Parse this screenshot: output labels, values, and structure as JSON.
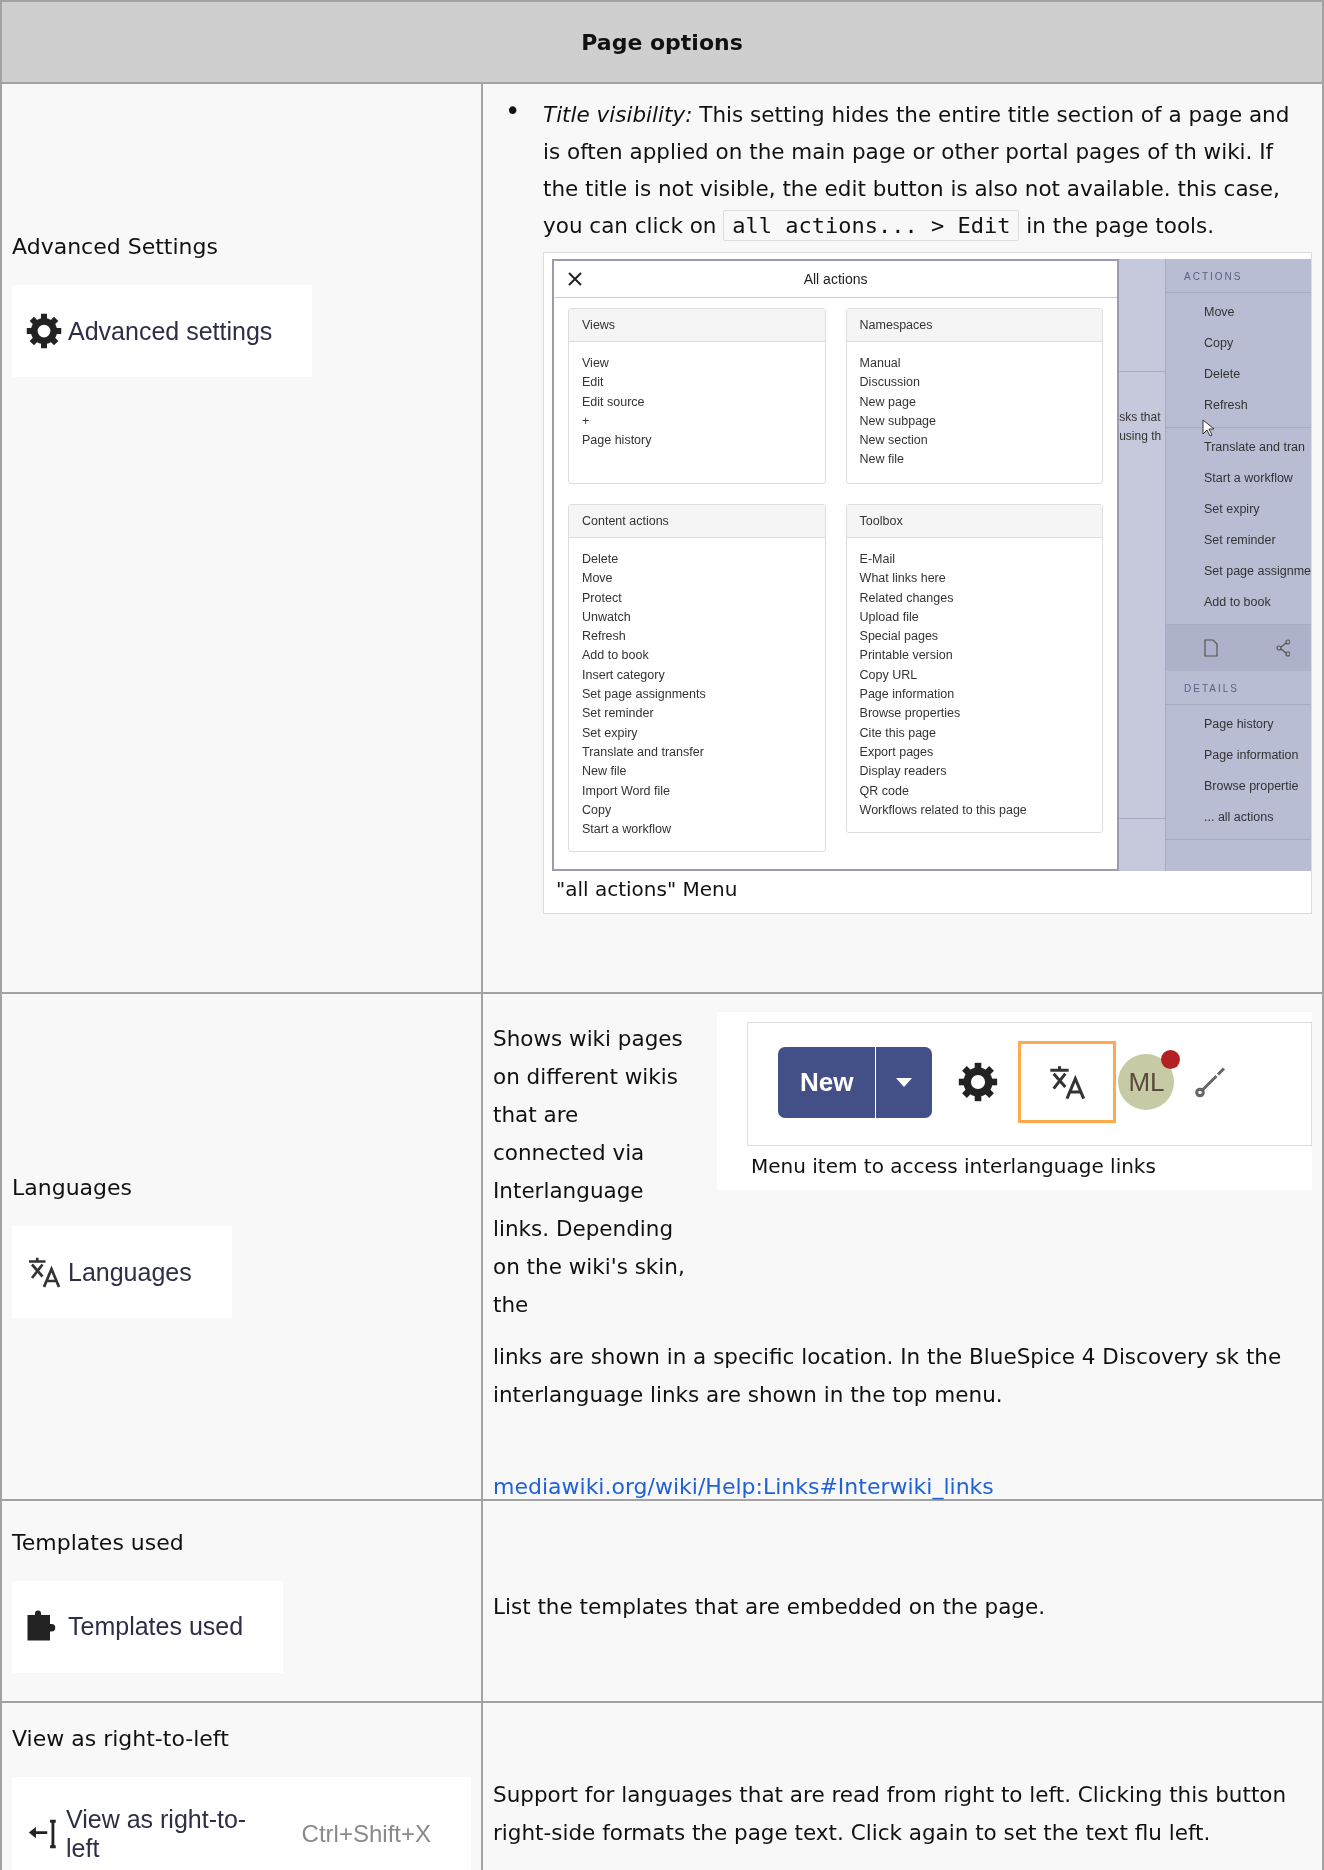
{
  "table": {
    "header": "Page options",
    "rows": [
      {
        "kind": "bullet_figure",
        "label": "Advanced Settings",
        "button": {
          "label": "Advanced settings"
        },
        "bullet": {
          "marker": "•",
          "text_before": "*Title visibility:* This setting hides the entire title section of a page and is often applied on the main page or other portal pages of th wiki. If the title is not visible, the edit button is also not available. this case, you can click on",
          "code": "all actions... > Edit",
          "text_after": "in the page tools."
        },
        "figure": {
          "dialog": {
            "title": "All actions",
            "panels": [
              {
                "title": "Views",
                "items": [
                  "View",
                  "Edit",
                  "Edit source",
                  "+",
                  "Page history"
                ]
              },
              {
                "title": "Namespaces",
                "items": [
                  "Manual",
                  "Discussion",
                  "New page",
                  "New subpage",
                  "New section",
                  "New file"
                ]
              },
              {
                "title": "Content actions",
                "items": [
                  "Delete",
                  "Move",
                  "Protect",
                  "Unwatch",
                  "Refresh",
                  "Add to book",
                  "Insert category",
                  "Set page assignments",
                  "Set reminder",
                  "Set expiry",
                  "Translate and transfer",
                  "New file",
                  "Import Word file",
                  "Copy",
                  "Start a workflow"
                ]
              },
              {
                "title": "Toolbox",
                "items": [
                  "E-Mail",
                  "What links here",
                  "Related changes",
                  "Upload file",
                  "Special pages",
                  "Printable version",
                  "Copy URL",
                  "Page information",
                  "Browse properties",
                  "Cite this page",
                  "Export pages",
                  "Display readers",
                  "QR code",
                  "Workflows related to this page"
                ]
              }
            ]
          },
          "background_text": [
            "sks that",
            "using th"
          ],
          "sidebar": {
            "actions_heading": "ACTIONS",
            "action_groups": [
              [
                "Move",
                "Copy",
                "Delete",
                "Refresh"
              ],
              [
                "Translate and tran",
                "Start a workflow",
                "Set expiry",
                "Set reminder",
                "Set page assignme",
                "Add to book"
              ]
            ],
            "details_heading": "DETAILS",
            "details": [
              "Page history",
              "Page information",
              "Browse propertie",
              "... all actions"
            ]
          },
          "caption": "\"all actions\" Menu"
        }
      },
      {
        "kind": "float_figure",
        "label": "Languages",
        "button": {
          "label": "Languages"
        },
        "text_beside": "Shows wiki pages on different wikis that are connected via Interlanguage links. Depending on the wiki's skin, the",
        "text": "links are shown in a specific location. In the BlueSpice 4 Discovery sk the interlanguage links are shown in the top menu.",
        "figure": {
          "new_button": "New",
          "avatar": "ML",
          "caption": "Menu item to access interlanguage links"
        },
        "link": "mediawiki.org/wiki/Help:Links#Interwiki_links"
      },
      {
        "kind": "text",
        "label": "Templates used",
        "button": {
          "label": "Templates used"
        },
        "text": "List the templates that are embedded on the page."
      },
      {
        "kind": "text",
        "label": "View as right-to-left",
        "button": {
          "label": "View as right-to-left",
          "shortcut": "Ctrl+Shift+X"
        },
        "text": "Support for languages that are read from right to left. Clicking this button right-side formats the page text. Click again to set the text flu left."
      }
    ]
  }
}
